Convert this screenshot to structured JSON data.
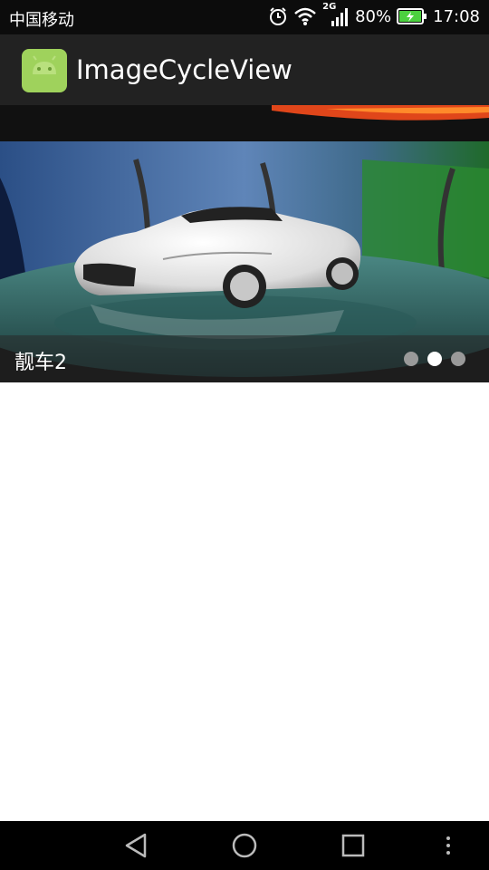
{
  "status_bar": {
    "carrier": "中国移动",
    "network_type": "2G",
    "battery": "80%",
    "time": "17:08",
    "icons": [
      "alarm-icon",
      "wifi-icon",
      "signal-icon",
      "battery-charging-icon"
    ]
  },
  "app_bar": {
    "title": "ImageCycleView",
    "icon": "android-app-icon"
  },
  "banner": {
    "caption": "靓车2",
    "slide_count": 3,
    "active_index": 1
  },
  "nav_bar": {
    "icons": [
      "back-icon",
      "home-icon",
      "recents-icon",
      "menu-icon"
    ]
  },
  "colors": {
    "status_bar": "#0c0c0c",
    "app_bar": "#222222",
    "android_green": "#9fd25c",
    "dot_active": "#ffffff",
    "dot_inactive": "#9a9a9a"
  }
}
